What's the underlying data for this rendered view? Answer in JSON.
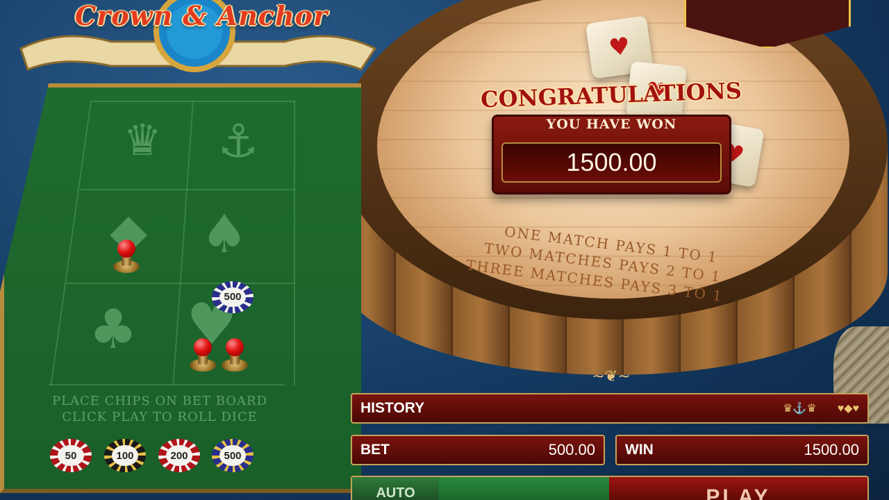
{
  "game": {
    "title": "Crown & Anchor"
  },
  "board": {
    "symbols": [
      "crown",
      "anchor",
      "diamond",
      "spade",
      "club",
      "heart"
    ],
    "instructions": [
      "PLACE CHIPS ON BET BOARD",
      "CLICK PLAY TO ROLL DICE"
    ],
    "placed_chip_label": "500"
  },
  "chips": [
    {
      "label": "50",
      "color": "#b0141a"
    },
    {
      "label": "100",
      "color": "#1a1a1a"
    },
    {
      "label": "200",
      "color": "#b0141a"
    },
    {
      "label": "500",
      "color": "#2a2f8c"
    }
  ],
  "win_popup": {
    "title": "CONGRATULATIONS",
    "subtitle": "YOU HAVE WON",
    "amount": "1500.00"
  },
  "paytable": [
    "ONE MATCH PAYS 1 TO 1",
    "TWO MATCHES PAYS 2 TO 1",
    "THREE MATCHES PAYS 3 TO 1"
  ],
  "history": {
    "label": "HISTORY",
    "entries": [
      "♛⚓♛",
      "♥◆♥"
    ]
  },
  "bet": {
    "label": "BET",
    "value": "500.00"
  },
  "win": {
    "label": "WIN",
    "value": "1500.00"
  },
  "buttons": {
    "auto": "AUTO",
    "play": "PLAY"
  },
  "colors": {
    "felt": "#1f6c2f",
    "panel_red": "#7a120d",
    "gold": "#c8a25a"
  }
}
